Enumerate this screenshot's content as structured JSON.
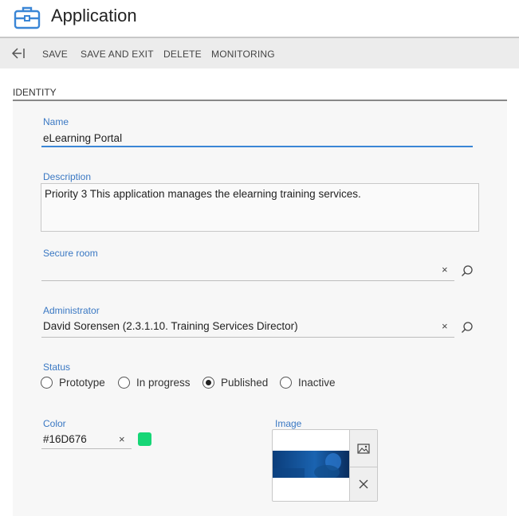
{
  "header": {
    "title": "Application",
    "icon": "briefcase-icon",
    "accent": "#3a86d6"
  },
  "toolbar": {
    "back_icon": "back-arrow-icon",
    "save": "SAVE",
    "save_and_exit": "SAVE AND EXIT",
    "delete": "DELETE",
    "monitoring": "MONITORING"
  },
  "section": {
    "title": "IDENTITY"
  },
  "form": {
    "name": {
      "label": "Name",
      "value": "eLearning Portal"
    },
    "description": {
      "label": "Description",
      "value": "Priority 3 This application manages the elearning training services."
    },
    "secure_room": {
      "label": "Secure room",
      "value": "",
      "clear": "×"
    },
    "administrator": {
      "label": "Administrator",
      "value": "David Sorensen  (2.3.1.10. Training Services Director)",
      "clear": "×"
    },
    "status": {
      "label": "Status",
      "options": [
        "Prototype",
        "In progress",
        "Published",
        "Inactive"
      ],
      "selected": "Published"
    },
    "color": {
      "label": "Color",
      "value": "#16D676",
      "clear": "×",
      "swatch": "#16D676"
    },
    "image": {
      "label": "Image",
      "pick_icon": "image-icon",
      "remove_icon": "close-icon"
    }
  }
}
